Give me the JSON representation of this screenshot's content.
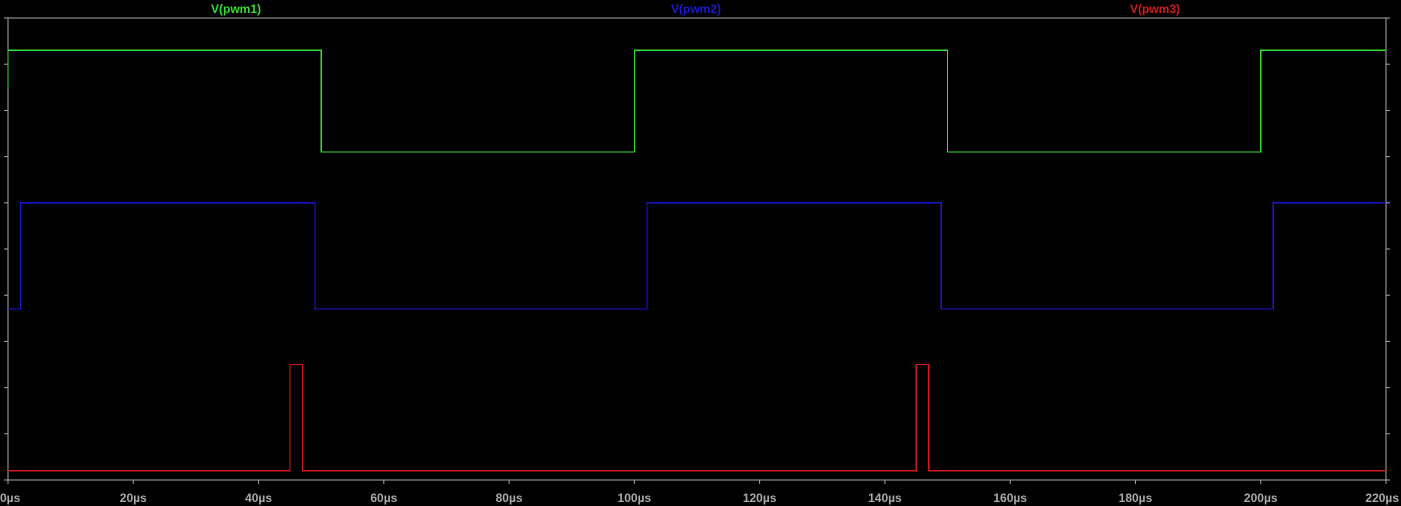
{
  "colors": {
    "background": "#000000",
    "frame": "#aaaaaa",
    "pwm1": "#33dd33",
    "pwm2": "#1a1ad2",
    "pwm3": "#d21a1a"
  },
  "chart_data": {
    "type": "line",
    "grid": false,
    "legend": "top (trace names above plot)",
    "x_unit": "µs",
    "xlim": [
      0,
      220
    ],
    "x_ticks": [
      0,
      20,
      40,
      60,
      80,
      100,
      120,
      140,
      160,
      180,
      200,
      220
    ],
    "x_tick_labels": [
      "0µs",
      "20µs",
      "40µs",
      "60µs",
      "80µs",
      "100µs",
      "120µs",
      "140µs",
      "160µs",
      "180µs",
      "200µs",
      "220µs"
    ],
    "ylim": [
      0,
      10
    ],
    "y_tick_count": 11,
    "series": [
      {
        "name": "V(pwm1)",
        "color": "#33dd33",
        "x": [
          0,
          0,
          50,
          50,
          100,
          100,
          150,
          150,
          200,
          200,
          220
        ],
        "y": [
          8.5,
          9.3,
          9.3,
          7.1,
          7.1,
          9.3,
          9.3,
          7.1,
          7.1,
          9.3,
          9.3
        ]
      },
      {
        "name": "V(pwm2)",
        "color": "#1a1ad2",
        "x": [
          0,
          2,
          2,
          49,
          49,
          102,
          102,
          149,
          149,
          202,
          202,
          220
        ],
        "y": [
          3.7,
          3.7,
          6,
          6,
          3.7,
          3.7,
          6,
          6,
          3.7,
          3.7,
          6,
          6
        ]
      },
      {
        "name": "V(pwm3)",
        "color": "#d21a1a",
        "x": [
          0,
          45,
          45,
          47,
          47,
          145,
          145,
          147,
          147,
          220
        ],
        "y": [
          0.2,
          0.2,
          2.5,
          2.5,
          0.2,
          0.2,
          2.5,
          2.5,
          0.2,
          0.2
        ]
      }
    ]
  }
}
